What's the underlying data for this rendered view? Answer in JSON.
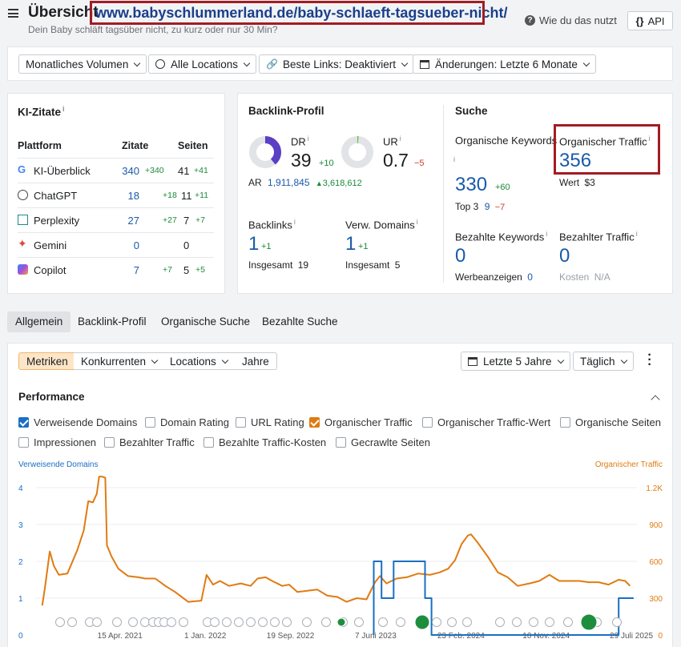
{
  "header": {
    "title": "Übersicht",
    "url": "www.babyschlummerland.de/baby-schlaeft-tagsueber-nicht/",
    "subtitle": "Dein Baby schläft tagsüber nicht, zu kurz oder nur 30 Min?",
    "help_label": "Wie du das nutzt",
    "api_label": "API"
  },
  "filters": {
    "volume": "Monatliches Volumen",
    "locations": "Alle Locations",
    "links": "Beste Links: Deaktiviert",
    "changes": "Änderungen: Letzte 6 Monate"
  },
  "ki": {
    "title": "KI-Zitate",
    "info": "i",
    "col_platform": "Plattform",
    "col_zitate": "Zitate",
    "col_seiten": "Seiten",
    "rows": [
      {
        "name": "KI-Überblick",
        "zitate": "340",
        "zitate_delta": "+340",
        "seiten": "41",
        "seiten_delta": "+41"
      },
      {
        "name": "ChatGPT",
        "zitate": "18",
        "zitate_delta": "+18",
        "seiten": "11",
        "seiten_delta": "+11"
      },
      {
        "name": "Perplexity",
        "zitate": "27",
        "zitate_delta": "+27",
        "seiten": "7",
        "seiten_delta": "+7"
      },
      {
        "name": "Gemini",
        "zitate": "0",
        "zitate_delta": "",
        "seiten": "0",
        "seiten_delta": ""
      },
      {
        "name": "Copilot",
        "zitate": "7",
        "zitate_delta": "+7",
        "seiten": "5",
        "seiten_delta": "+5"
      }
    ]
  },
  "backlink": {
    "title": "Backlink-Profil",
    "dr_label": "DR",
    "dr": "39",
    "dr_delta": "+10",
    "dr_fraction": 0.39,
    "ur_label": "UR",
    "ur": "0.7",
    "ur_delta": "−5",
    "ur_fraction": 0.007,
    "ar_label": "AR",
    "ar": "1,911,845",
    "ar_delta": "3,618,612",
    "backlinks_label": "Backlinks",
    "backlinks": "1",
    "backlinks_delta": "+1",
    "backlinks_total_label": "Insgesamt",
    "backlinks_total": "19",
    "domains_label": "Verw. Domains",
    "domains": "1",
    "domains_delta": "+1",
    "domains_total_label": "Insgesamt",
    "domains_total": "5"
  },
  "suche": {
    "title": "Suche",
    "org_kw_label": "Organische Keywords",
    "org_kw": "330",
    "org_kw_delta": "+60",
    "top3_label": "Top 3",
    "top3": "9",
    "top3_delta": "−7",
    "org_traffic_label": "Organischer Traffic",
    "org_traffic": "356",
    "wert_label": "Wert",
    "wert": "$3",
    "paid_kw_label": "Bezahlte Keywords",
    "paid_kw": "0",
    "ads_label": "Werbeanzeigen",
    "ads": "0",
    "paid_traffic_label": "Bezahlter Traffic",
    "paid_traffic": "0",
    "kosten_label": "Kosten",
    "kosten": "N/A"
  },
  "tabs": [
    "Allgemein",
    "Backlink-Profil",
    "Organische Suche",
    "Bezahlte Suche"
  ],
  "perf_toolbar": {
    "segments": [
      "Metriken",
      "Konkurrenten",
      "Locations",
      "Jahre"
    ],
    "period": "Letzte 5 Jahre",
    "granularity": "Täglich"
  },
  "performance": {
    "title": "Performance",
    "checkboxes": [
      {
        "label": "Verweisende Domains",
        "checked": true,
        "color": "#1a6fc4"
      },
      {
        "label": "Domain Rating",
        "checked": false
      },
      {
        "label": "URL Rating",
        "checked": false
      },
      {
        "label": "Organischer Traffic",
        "checked": true,
        "color": "#e07b12"
      },
      {
        "label": "Organischer Traffic-Wert",
        "checked": false
      },
      {
        "label": "Organische Seiten",
        "checked": false
      },
      {
        "label": "Impressionen",
        "checked": false
      },
      {
        "label": "Bezahlter Traffic",
        "checked": false
      },
      {
        "label": "Bezahlte Traffic-Kosten",
        "checked": false
      },
      {
        "label": "Gecrawlte Seiten",
        "checked": false
      }
    ]
  },
  "chart_data": {
    "type": "line",
    "left_axis_label": "Verweisende Domains",
    "right_axis_label": "Organischer Traffic",
    "left_ticks": [
      "0",
      "1",
      "2",
      "3",
      "4"
    ],
    "right_ticks": [
      "0",
      "300",
      "600",
      "900",
      "1.2K"
    ],
    "x_ticks": [
      "15 Apr. 2021",
      "1 Jan. 2022",
      "19 Sep. 2022",
      "7 Juni 2023",
      "23 Feb. 2024",
      "10 Nov. 2024",
      "29 Juli 2025"
    ],
    "x_range": [
      "2020-08-01",
      "2025-08-15"
    ],
    "ylim_left": [
      0,
      4
    ],
    "ylim_right": [
      0,
      1200
    ],
    "series": [
      {
        "name": "Organischer Traffic",
        "axis": "right",
        "color": "#e07b12",
        "points": [
          [
            "2020-08-20",
            240
          ],
          [
            "2020-08-28",
            380
          ],
          [
            "2020-09-12",
            680
          ],
          [
            "2020-09-25",
            560
          ],
          [
            "2020-10-10",
            490
          ],
          [
            "2020-11-05",
            500
          ],
          [
            "2020-12-05",
            690
          ],
          [
            "2020-12-25",
            850
          ],
          [
            "2021-01-08",
            1090
          ],
          [
            "2021-01-22",
            1080
          ],
          [
            "2021-02-03",
            1150
          ],
          [
            "2021-02-10",
            1290
          ],
          [
            "2021-02-20",
            1290
          ],
          [
            "2021-03-01",
            1280
          ],
          [
            "2021-03-06",
            730
          ],
          [
            "2021-03-20",
            640
          ],
          [
            "2021-04-10",
            540
          ],
          [
            "2021-05-10",
            480
          ],
          [
            "2021-06-10",
            470
          ],
          [
            "2021-07-01",
            460
          ],
          [
            "2021-08-01",
            460
          ],
          [
            "2021-09-01",
            400
          ],
          [
            "2021-10-01",
            350
          ],
          [
            "2021-11-10",
            270
          ],
          [
            "2021-12-20",
            280
          ],
          [
            "2022-01-05",
            490
          ],
          [
            "2022-01-25",
            410
          ],
          [
            "2022-02-15",
            440
          ],
          [
            "2022-03-15",
            400
          ],
          [
            "2022-04-20",
            420
          ],
          [
            "2022-05-20",
            400
          ],
          [
            "2022-06-10",
            460
          ],
          [
            "2022-07-05",
            470
          ],
          [
            "2022-07-25",
            440
          ],
          [
            "2022-08-25",
            400
          ],
          [
            "2022-09-15",
            410
          ],
          [
            "2022-10-10",
            350
          ],
          [
            "2022-11-10",
            360
          ],
          [
            "2022-12-10",
            370
          ],
          [
            "2023-01-10",
            320
          ],
          [
            "2023-02-10",
            310
          ],
          [
            "2023-03-10",
            270
          ],
          [
            "2023-04-10",
            300
          ],
          [
            "2023-05-10",
            290
          ],
          [
            "2023-06-05",
            430
          ],
          [
            "2023-06-20",
            480
          ],
          [
            "2023-07-10",
            420
          ],
          [
            "2023-08-10",
            460
          ],
          [
            "2023-09-10",
            470
          ],
          [
            "2023-10-15",
            500
          ],
          [
            "2023-11-20",
            490
          ],
          [
            "2023-12-20",
            510
          ],
          [
            "2024-01-15",
            540
          ],
          [
            "2024-02-05",
            610
          ],
          [
            "2024-02-25",
            740
          ],
          [
            "2024-03-15",
            810
          ],
          [
            "2024-03-25",
            820
          ],
          [
            "2024-04-15",
            750
          ],
          [
            "2024-05-15",
            640
          ],
          [
            "2024-06-15",
            510
          ],
          [
            "2024-07-15",
            470
          ],
          [
            "2024-08-15",
            400
          ],
          [
            "2024-09-20",
            420
          ],
          [
            "2024-10-20",
            440
          ],
          [
            "2024-11-20",
            490
          ],
          [
            "2024-12-20",
            440
          ],
          [
            "2025-01-20",
            440
          ],
          [
            "2025-02-20",
            440
          ],
          [
            "2025-03-20",
            430
          ],
          [
            "2025-04-20",
            430
          ],
          [
            "2025-05-20",
            410
          ],
          [
            "2025-06-20",
            450
          ],
          [
            "2025-07-10",
            440
          ],
          [
            "2025-07-25",
            400
          ]
        ]
      },
      {
        "name": "Verweisende Domains",
        "axis": "left",
        "color": "#1a6fc4",
        "points": [
          [
            "2023-06-01",
            0
          ],
          [
            "2023-06-01",
            2
          ],
          [
            "2023-06-25",
            2
          ],
          [
            "2023-06-25",
            1
          ],
          [
            "2023-08-01",
            1
          ],
          [
            "2023-08-01",
            2
          ],
          [
            "2023-11-05",
            2
          ],
          [
            "2023-11-05",
            1
          ],
          [
            "2023-11-25",
            1
          ],
          [
            "2023-11-25",
            0
          ],
          [
            "2025-06-20",
            0
          ],
          [
            "2025-06-20",
            1
          ],
          [
            "2025-08-05",
            1
          ]
        ]
      }
    ]
  }
}
